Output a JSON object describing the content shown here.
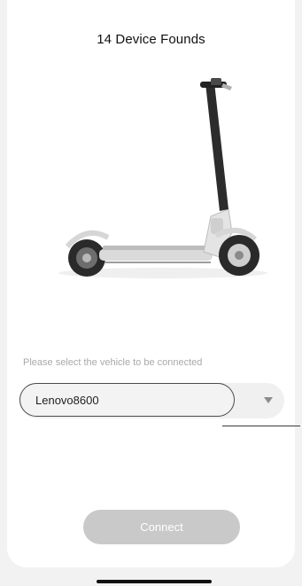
{
  "header": {
    "title": "14 Device Founds"
  },
  "device_select": {
    "prompt": "Please select the vehicle to be connected",
    "selected_value": "Lenovo8600"
  },
  "actions": {
    "connect_label": "Connect"
  },
  "colors": {
    "connect_button_disabled": "#c9c9c9",
    "select_border": "#4a4a4a",
    "prompt_text": "#a9a9a9"
  },
  "icons": {
    "dropdown": "caret-down-icon",
    "vehicle": "scooter-image"
  }
}
